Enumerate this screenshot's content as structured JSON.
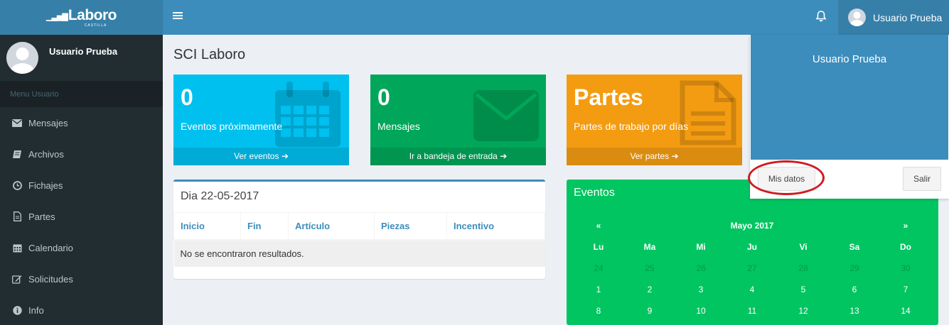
{
  "app": {
    "logo_text": "Laboro",
    "logo_sub": "CASTILLA"
  },
  "navbar": {
    "user_name": "Usuario Prueba"
  },
  "sidebar": {
    "user_name": "Usuario Prueba",
    "header": "Menu Usuario",
    "items": [
      {
        "label": "Mensajes",
        "icon": "envelope-icon"
      },
      {
        "label": "Archivos",
        "icon": "book-icon"
      },
      {
        "label": "Fichajes",
        "icon": "clock-icon"
      },
      {
        "label": "Partes",
        "icon": "file-icon"
      },
      {
        "label": "Calendario",
        "icon": "calendar-icon"
      },
      {
        "label": "Solicitudes",
        "icon": "edit-icon"
      },
      {
        "label": "Info",
        "icon": "info-icon"
      }
    ]
  },
  "page": {
    "title": "SCI Laboro"
  },
  "boxes": [
    {
      "number": "0",
      "label": "Eventos próximamente",
      "footer": "Ver eventos",
      "color": "#00c0ef",
      "icon": "calendar-icon"
    },
    {
      "number": "0",
      "label": "Mensajes",
      "footer": "Ir a bandeja de entrada",
      "color": "#00a65a",
      "icon": "envelope-icon"
    },
    {
      "number": "Partes",
      "label": "Partes de trabajo por días",
      "footer": "Ver partes",
      "color": "#f39c12",
      "icon": "file-icon"
    }
  ],
  "day_table": {
    "title": "Dia 22-05-2017",
    "columns": [
      "Inicio",
      "Fin",
      "Artículo",
      "Piezas",
      "Incentivo"
    ],
    "empty_message": "No se encontraron resultados."
  },
  "events": {
    "title": "Eventos",
    "prev": "«",
    "next": "»",
    "month": "Mayo 2017",
    "weekdays": [
      "Lu",
      "Ma",
      "Mi",
      "Ju",
      "Vi",
      "Sa",
      "Do"
    ],
    "rows": [
      [
        "24",
        "25",
        "26",
        "27",
        "28",
        "29",
        "30"
      ],
      [
        "1",
        "2",
        "3",
        "4",
        "5",
        "6",
        "7"
      ],
      [
        "8",
        "9",
        "10",
        "11",
        "12",
        "13",
        "14"
      ]
    ]
  },
  "dropdown": {
    "user_name": "Usuario Prueba",
    "profile_button": "Mis datos",
    "logout_button": "Salir"
  },
  "colors": {
    "navbar": "#3c8dbc",
    "sidebar": "#222d32",
    "events": "#00c561",
    "highlight_ring": "#d11a1f"
  }
}
